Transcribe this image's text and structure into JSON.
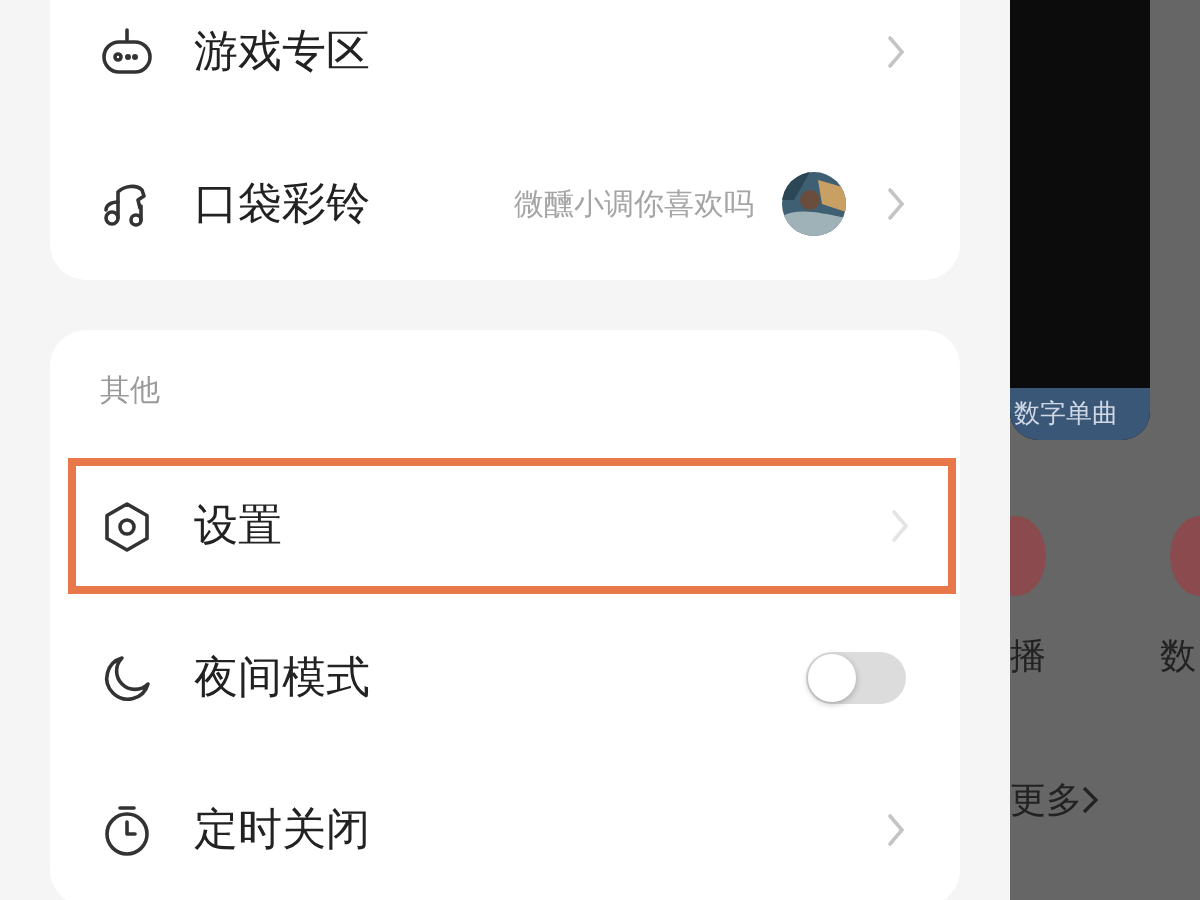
{
  "menu_groups": [
    {
      "rows": [
        {
          "kind": "link",
          "label": "游戏专区",
          "highlighted": false
        },
        {
          "kind": "link",
          "label": "口袋彩铃",
          "value": "微醺小调你喜欢吗",
          "highlighted": false
        }
      ]
    },
    {
      "header": "其他",
      "rows": [
        {
          "kind": "link",
          "label": "设置",
          "highlighted": true
        },
        {
          "kind": "toggle",
          "label": "夜间模式",
          "on": false,
          "highlighted": false
        },
        {
          "kind": "link",
          "label": "定时关闭",
          "highlighted": false
        }
      ]
    }
  ],
  "background_panel": {
    "tile_caption": "数字单曲",
    "labels": [
      "播",
      "数"
    ],
    "more": "更多"
  }
}
